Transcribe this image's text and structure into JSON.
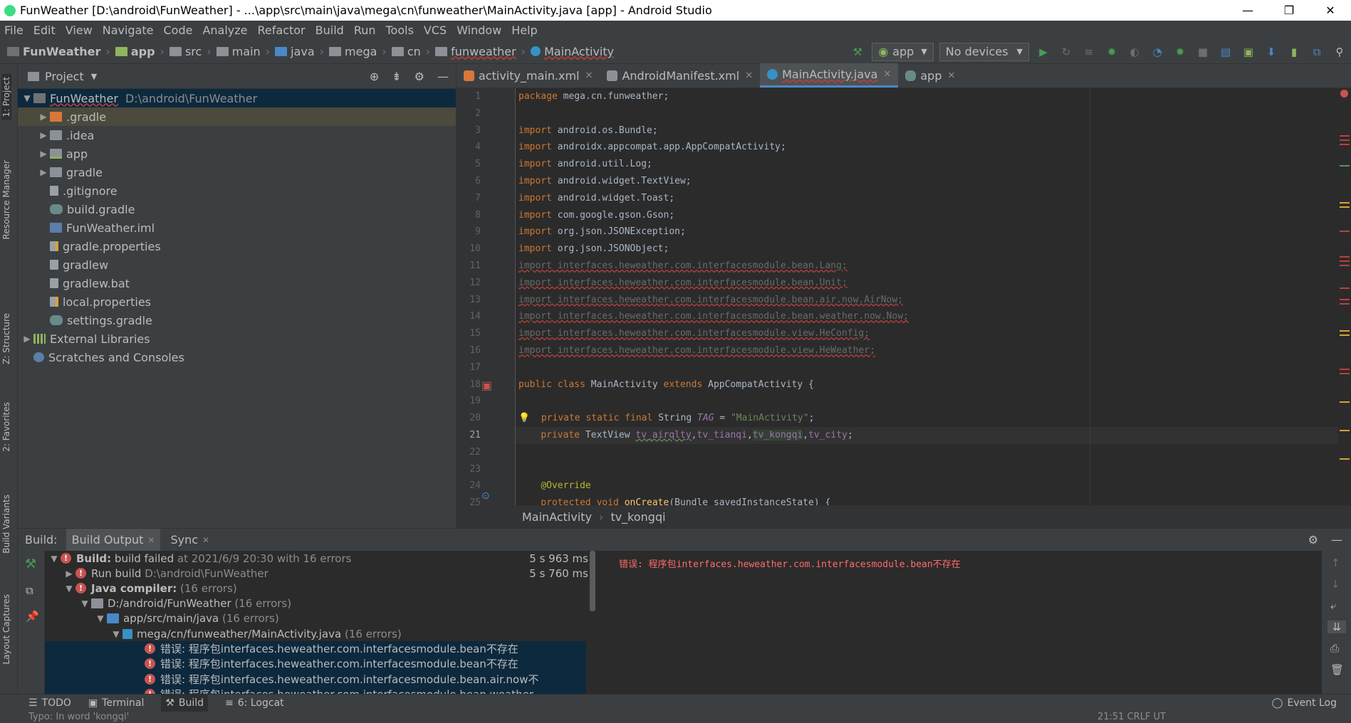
{
  "window": {
    "title": "FunWeather [D:\\android\\FunWeather] - ...\\app\\src\\main\\java\\mega\\cn\\funweather\\MainActivity.java [app] - Android Studio",
    "minimize": "—",
    "maximize": "❐",
    "close": "✕"
  },
  "menu": [
    "File",
    "Edit",
    "View",
    "Navigate",
    "Code",
    "Analyze",
    "Refactor",
    "Build",
    "Run",
    "Tools",
    "VCS",
    "Window",
    "Help"
  ],
  "breadcrumb": [
    "FunWeather",
    "app",
    "src",
    "main",
    "java",
    "mega",
    "cn",
    "funweather",
    "MainActivity"
  ],
  "toolbar": {
    "config": "app",
    "devices": "No devices"
  },
  "leftstrip": {
    "project": "1: Project",
    "resource": "Resource Manager",
    "structure": "Z: Structure",
    "favorites": "2: Favorites",
    "variants": "Build Variants",
    "captures": "Layout Captures"
  },
  "project": {
    "header": "Project",
    "root": "FunWeather",
    "root_path": "D:\\android\\FunWeather",
    "items": [
      ".gradle",
      ".idea",
      "app",
      "gradle",
      ".gitignore",
      "build.gradle",
      "FunWeather.iml",
      "gradle.properties",
      "gradlew",
      "gradlew.bat",
      "local.properties",
      "settings.gradle"
    ],
    "external": "External Libraries",
    "scratches": "Scratches and Consoles"
  },
  "tabs": [
    "activity_main.xml",
    "AndroidManifest.xml",
    "MainActivity.java",
    "app"
  ],
  "code": {
    "line_numbers": [
      "1",
      "2",
      "3",
      "4",
      "5",
      "6",
      "7",
      "8",
      "9",
      "10",
      "11",
      "12",
      "13",
      "14",
      "15",
      "16",
      "17",
      "18",
      "19",
      "20",
      "21",
      "22",
      "23",
      "24",
      "25"
    ]
  },
  "editor_breadcrumb": [
    "MainActivity",
    "tv_kongqi"
  ],
  "build": {
    "label": "Build:",
    "tabs": [
      "Build Output",
      "Sync"
    ],
    "rows": [
      {
        "title": "Build:",
        "text": "build failed",
        "meta": "at 2021/6/9 20:30  with 16 errors",
        "time": "5 s 963 ms"
      },
      {
        "text": "Run build",
        "meta": "D:\\android\\FunWeather",
        "time": "5 s 760 ms"
      },
      {
        "title": "Java compiler:",
        "meta": "(16 errors)"
      },
      {
        "text": "D:/android/FunWeather",
        "meta": "(16 errors)"
      },
      {
        "text": "app/src/main/java",
        "meta": "(16 errors)"
      },
      {
        "text": "mega/cn/funweather/MainActivity.java",
        "meta": "(16 errors)"
      },
      {
        "text": "错误: 程序包interfaces.heweather.com.interfacesmodule.bean不存在"
      },
      {
        "text": "错误: 程序包interfaces.heweather.com.interfacesmodule.bean不存在"
      },
      {
        "text": "错误: 程序包interfaces.heweather.com.interfacesmodule.bean.air.now不"
      },
      {
        "text": "错误: 程序包interfaces.heweather.com.interfacesmodule.bean.weather..."
      }
    ],
    "output": "错误: 程序包interfaces.heweather.com.interfacesmodule.bean不存在"
  },
  "bottom": {
    "todo": "TODO",
    "terminal": "Terminal",
    "build": "Build",
    "logcat": "6: Logcat",
    "eventlog": "Event Log"
  },
  "status": {
    "left": "Typo: In word 'kongqi'",
    "right": "21:51  CRLF  UT"
  }
}
